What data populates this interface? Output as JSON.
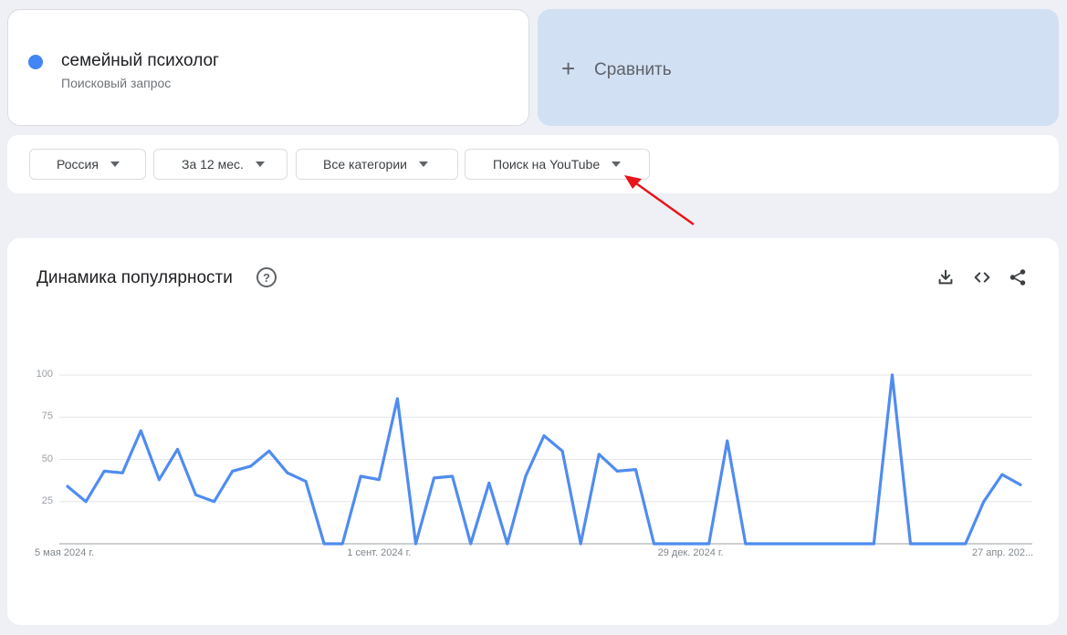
{
  "term": {
    "name": "семейный психолог",
    "type": "Поисковый запрос",
    "color": "#4285f4"
  },
  "compare": {
    "icon": "plus-icon",
    "label": "Сравнить"
  },
  "filters": [
    {
      "label": "Россия"
    },
    {
      "label": "За 12 мес."
    },
    {
      "label": "Все категории"
    },
    {
      "label": "Поиск на YouTube"
    }
  ],
  "chart": {
    "title": "Динамика популярности",
    "help_icon": "help-icon",
    "actions": [
      "download-icon",
      "embed-code-icon",
      "share-icon"
    ]
  },
  "chart_data": {
    "type": "line",
    "title": "Динамика популярности",
    "xlabel": "",
    "ylabel": "",
    "ylim": [
      0,
      100
    ],
    "yticks": [
      25,
      50,
      75,
      100
    ],
    "grid": true,
    "x_tick_labels": [
      "5 мая 2024 г.",
      "1 сент. 2024 г.",
      "29 дек. 2024 г.",
      "27 апр. 202..."
    ],
    "x_tick_indices": [
      0,
      17,
      34,
      51
    ],
    "series": [
      {
        "color": "#4f8cf0",
        "values": [
          34,
          25,
          43,
          42,
          67,
          38,
          56,
          29,
          25,
          43,
          46,
          55,
          42,
          37,
          0,
          0,
          40,
          38,
          86,
          0,
          39,
          40,
          0,
          36,
          0,
          40,
          64,
          55,
          0,
          53,
          43,
          44,
          0,
          0,
          0,
          0,
          61,
          0,
          0,
          0,
          0,
          0,
          0,
          0,
          0,
          100,
          0,
          0,
          0,
          0,
          25,
          41,
          35
        ]
      }
    ]
  },
  "annotation": {
    "arrow_color": "#e8141b"
  }
}
